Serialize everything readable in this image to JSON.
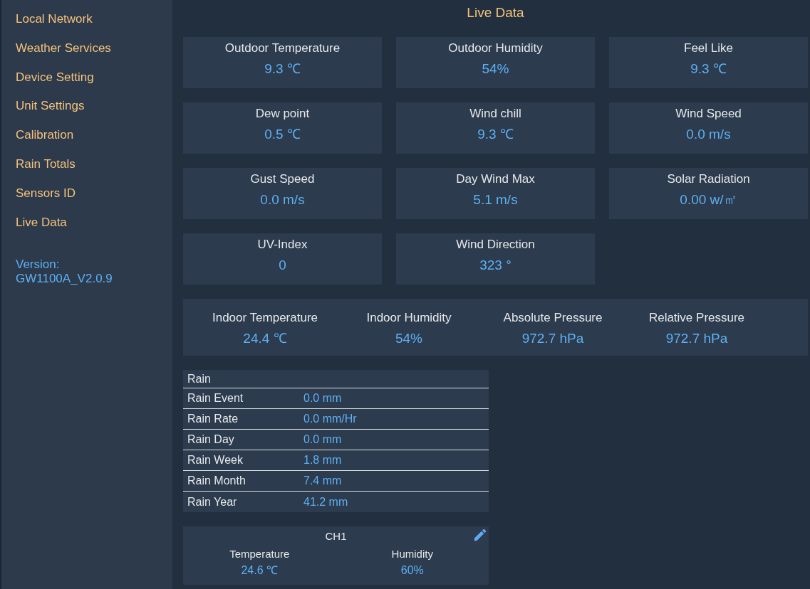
{
  "sidebar": {
    "items": [
      {
        "label": "Local Network"
      },
      {
        "label": "Weather Services"
      },
      {
        "label": "Device Setting"
      },
      {
        "label": "Unit Settings"
      },
      {
        "label": "Calibration"
      },
      {
        "label": "Rain Totals"
      },
      {
        "label": "Sensors ID"
      },
      {
        "label": "Live Data"
      }
    ],
    "version_label": "Version:",
    "version": "GW1100A_V2.0.9"
  },
  "title": "Live Data",
  "cards": [
    {
      "label": "Outdoor Temperature",
      "value": "9.3 ℃"
    },
    {
      "label": "Outdoor Humidity",
      "value": "54%"
    },
    {
      "label": "Feel Like",
      "value": "9.3 ℃"
    },
    {
      "label": "Dew point",
      "value": "0.5 ℃"
    },
    {
      "label": "Wind chill",
      "value": "9.3 ℃"
    },
    {
      "label": "Wind Speed",
      "value": "0.0 m/s"
    },
    {
      "label": "Gust Speed",
      "value": "0.0 m/s"
    },
    {
      "label": "Day Wind Max",
      "value": "5.1 m/s"
    },
    {
      "label": "Solar Radiation",
      "value": "0.00 w/㎡"
    },
    {
      "label": "UV-Index",
      "value": "0"
    },
    {
      "label": "Wind Direction",
      "value": "323 °"
    }
  ],
  "indoor": [
    {
      "label": "Indoor Temperature",
      "value": "24.4 ℃"
    },
    {
      "label": "Indoor Humidity",
      "value": "54%"
    },
    {
      "label": "Absolute Pressure",
      "value": "972.7 hPa"
    },
    {
      "label": "Relative Pressure",
      "value": "972.7 hPa"
    }
  ],
  "rain": {
    "title": "Rain",
    "rows": [
      {
        "label": "Rain Event",
        "value": "0.0 mm"
      },
      {
        "label": "Rain Rate",
        "value": "0.0 mm/Hr"
      },
      {
        "label": "Rain Day",
        "value": "0.0 mm"
      },
      {
        "label": "Rain Week",
        "value": "1.8 mm"
      },
      {
        "label": "Rain Month",
        "value": "7.4 mm"
      },
      {
        "label": "Rain Year",
        "value": "41.2 mm"
      }
    ]
  },
  "channel": {
    "title": "CH1",
    "fields": [
      {
        "label": "Temperature",
        "value": "24.6 ℃"
      },
      {
        "label": "Humidity",
        "value": "60%"
      }
    ]
  }
}
